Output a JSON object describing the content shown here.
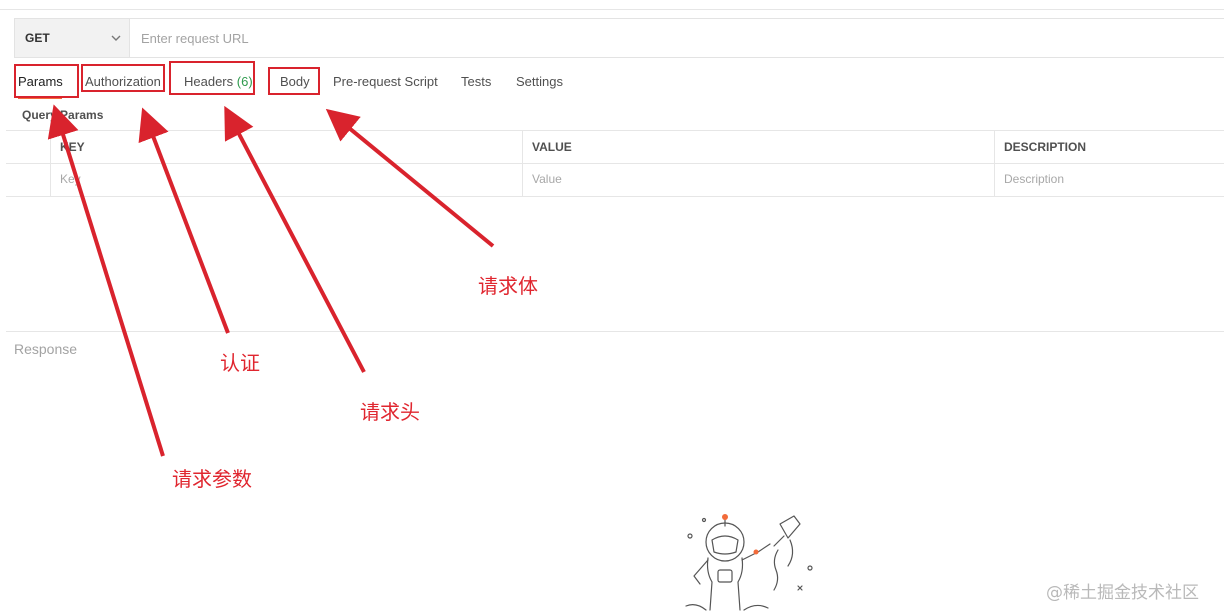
{
  "request": {
    "method": "GET",
    "url_placeholder": "Enter request URL"
  },
  "tabs": [
    {
      "label": "Params"
    },
    {
      "label": "Authorization"
    },
    {
      "label": "Headers",
      "count": "(6)"
    },
    {
      "label": "Body"
    },
    {
      "label": "Pre-request Script"
    },
    {
      "label": "Tests"
    },
    {
      "label": "Settings"
    }
  ],
  "query_params": {
    "title": "Query Params",
    "columns": [
      "KEY",
      "VALUE",
      "DESCRIPTION"
    ],
    "placeholders": [
      "Key",
      "Value",
      "Description"
    ]
  },
  "response": {
    "label": "Response"
  },
  "annotations": {
    "params": "请求参数",
    "authorization": "认证",
    "headers": "请求头",
    "body": "请求体"
  },
  "watermark": "@稀土掘金技术社区",
  "colors": {
    "annotation_red": "#d9232d",
    "active_tab_underline": "#f26b3a",
    "headers_count_green": "#2e9a4d"
  }
}
